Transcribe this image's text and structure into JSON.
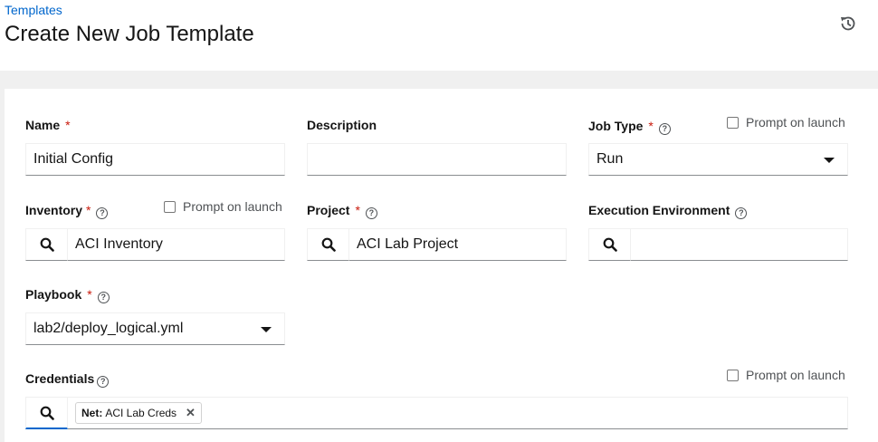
{
  "header": {
    "breadcrumb": "Templates",
    "title": "Create New Job Template",
    "history_icon": "history-icon"
  },
  "form": {
    "name": {
      "label": "Name",
      "required": "*",
      "value": "Initial Config"
    },
    "description": {
      "label": "Description",
      "value": ""
    },
    "job_type": {
      "label": "Job Type",
      "required": "*",
      "value": "Run",
      "prompt": "Prompt on launch"
    },
    "inventory": {
      "label": "Inventory",
      "required": "*",
      "value": "ACI Inventory",
      "prompt": "Prompt on launch"
    },
    "project": {
      "label": "Project",
      "required": "*",
      "value": "ACI Lab Project"
    },
    "execution_environment": {
      "label": "Execution Environment",
      "value": ""
    },
    "playbook": {
      "label": "Playbook",
      "required": "*",
      "value": "lab2/deploy_logical.yml"
    },
    "credentials": {
      "label": "Credentials",
      "prompt": "Prompt on launch",
      "chips": [
        {
          "type": "Net:",
          "name": "ACI Lab Creds"
        }
      ]
    }
  },
  "colors": {
    "link": "#0066cc",
    "required": "#c9190b",
    "page_bg": "#f0f0f0"
  }
}
